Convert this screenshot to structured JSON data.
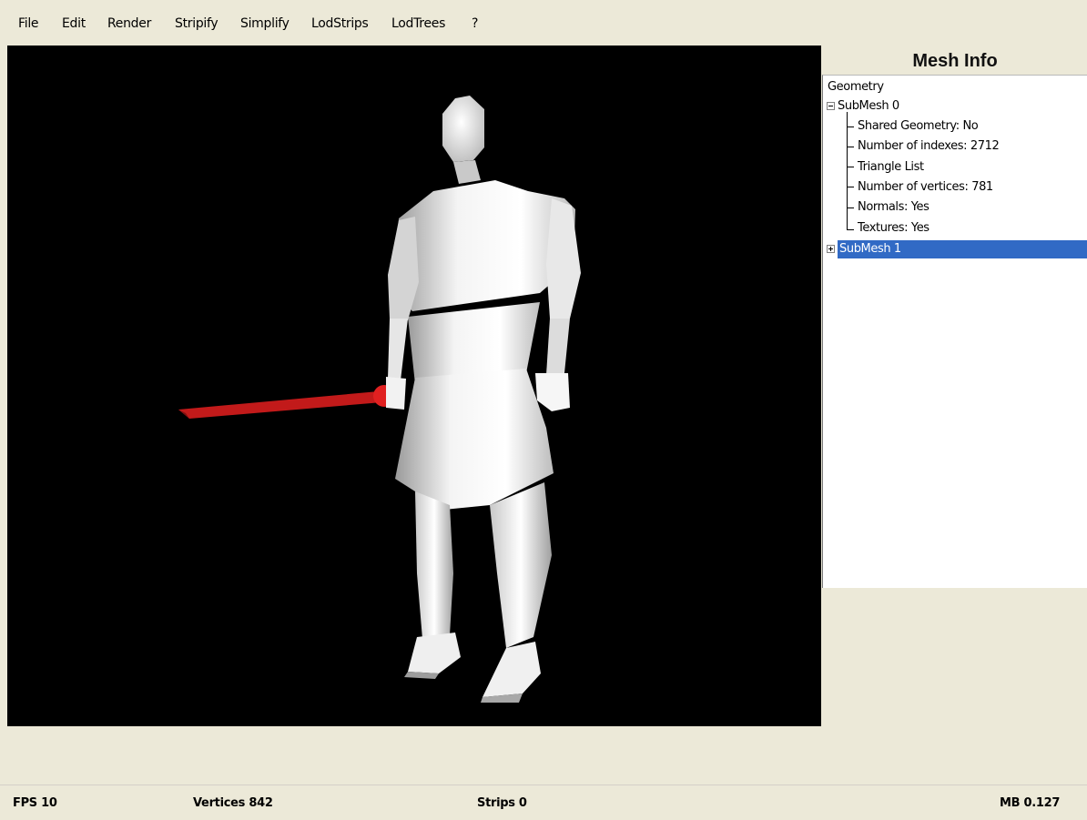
{
  "menu": [
    "File",
    "Edit",
    "Render",
    "Stripify",
    "Simplify",
    "LodStrips",
    "LodTrees",
    "?"
  ],
  "panel": {
    "title": "Mesh Info",
    "root": "Geometry",
    "submesh0": {
      "label": "SubMesh 0",
      "children": [
        "Shared Geometry: No",
        "Number of indexes: 2712",
        "Triangle List",
        "Number of vertices: 781",
        "Normals: Yes",
        "Textures: Yes"
      ]
    },
    "submesh1": {
      "label": "SubMesh 1",
      "selected": true
    }
  },
  "status": {
    "fps": "FPS 10",
    "vertices": "Vertices 842",
    "strips": "Strips 0",
    "mb": "MB 0.127"
  },
  "colors": {
    "viewport_bg": "#000000",
    "selection": "#316ac5",
    "model_body": "#e8e8e8",
    "sword": "#c01818"
  }
}
